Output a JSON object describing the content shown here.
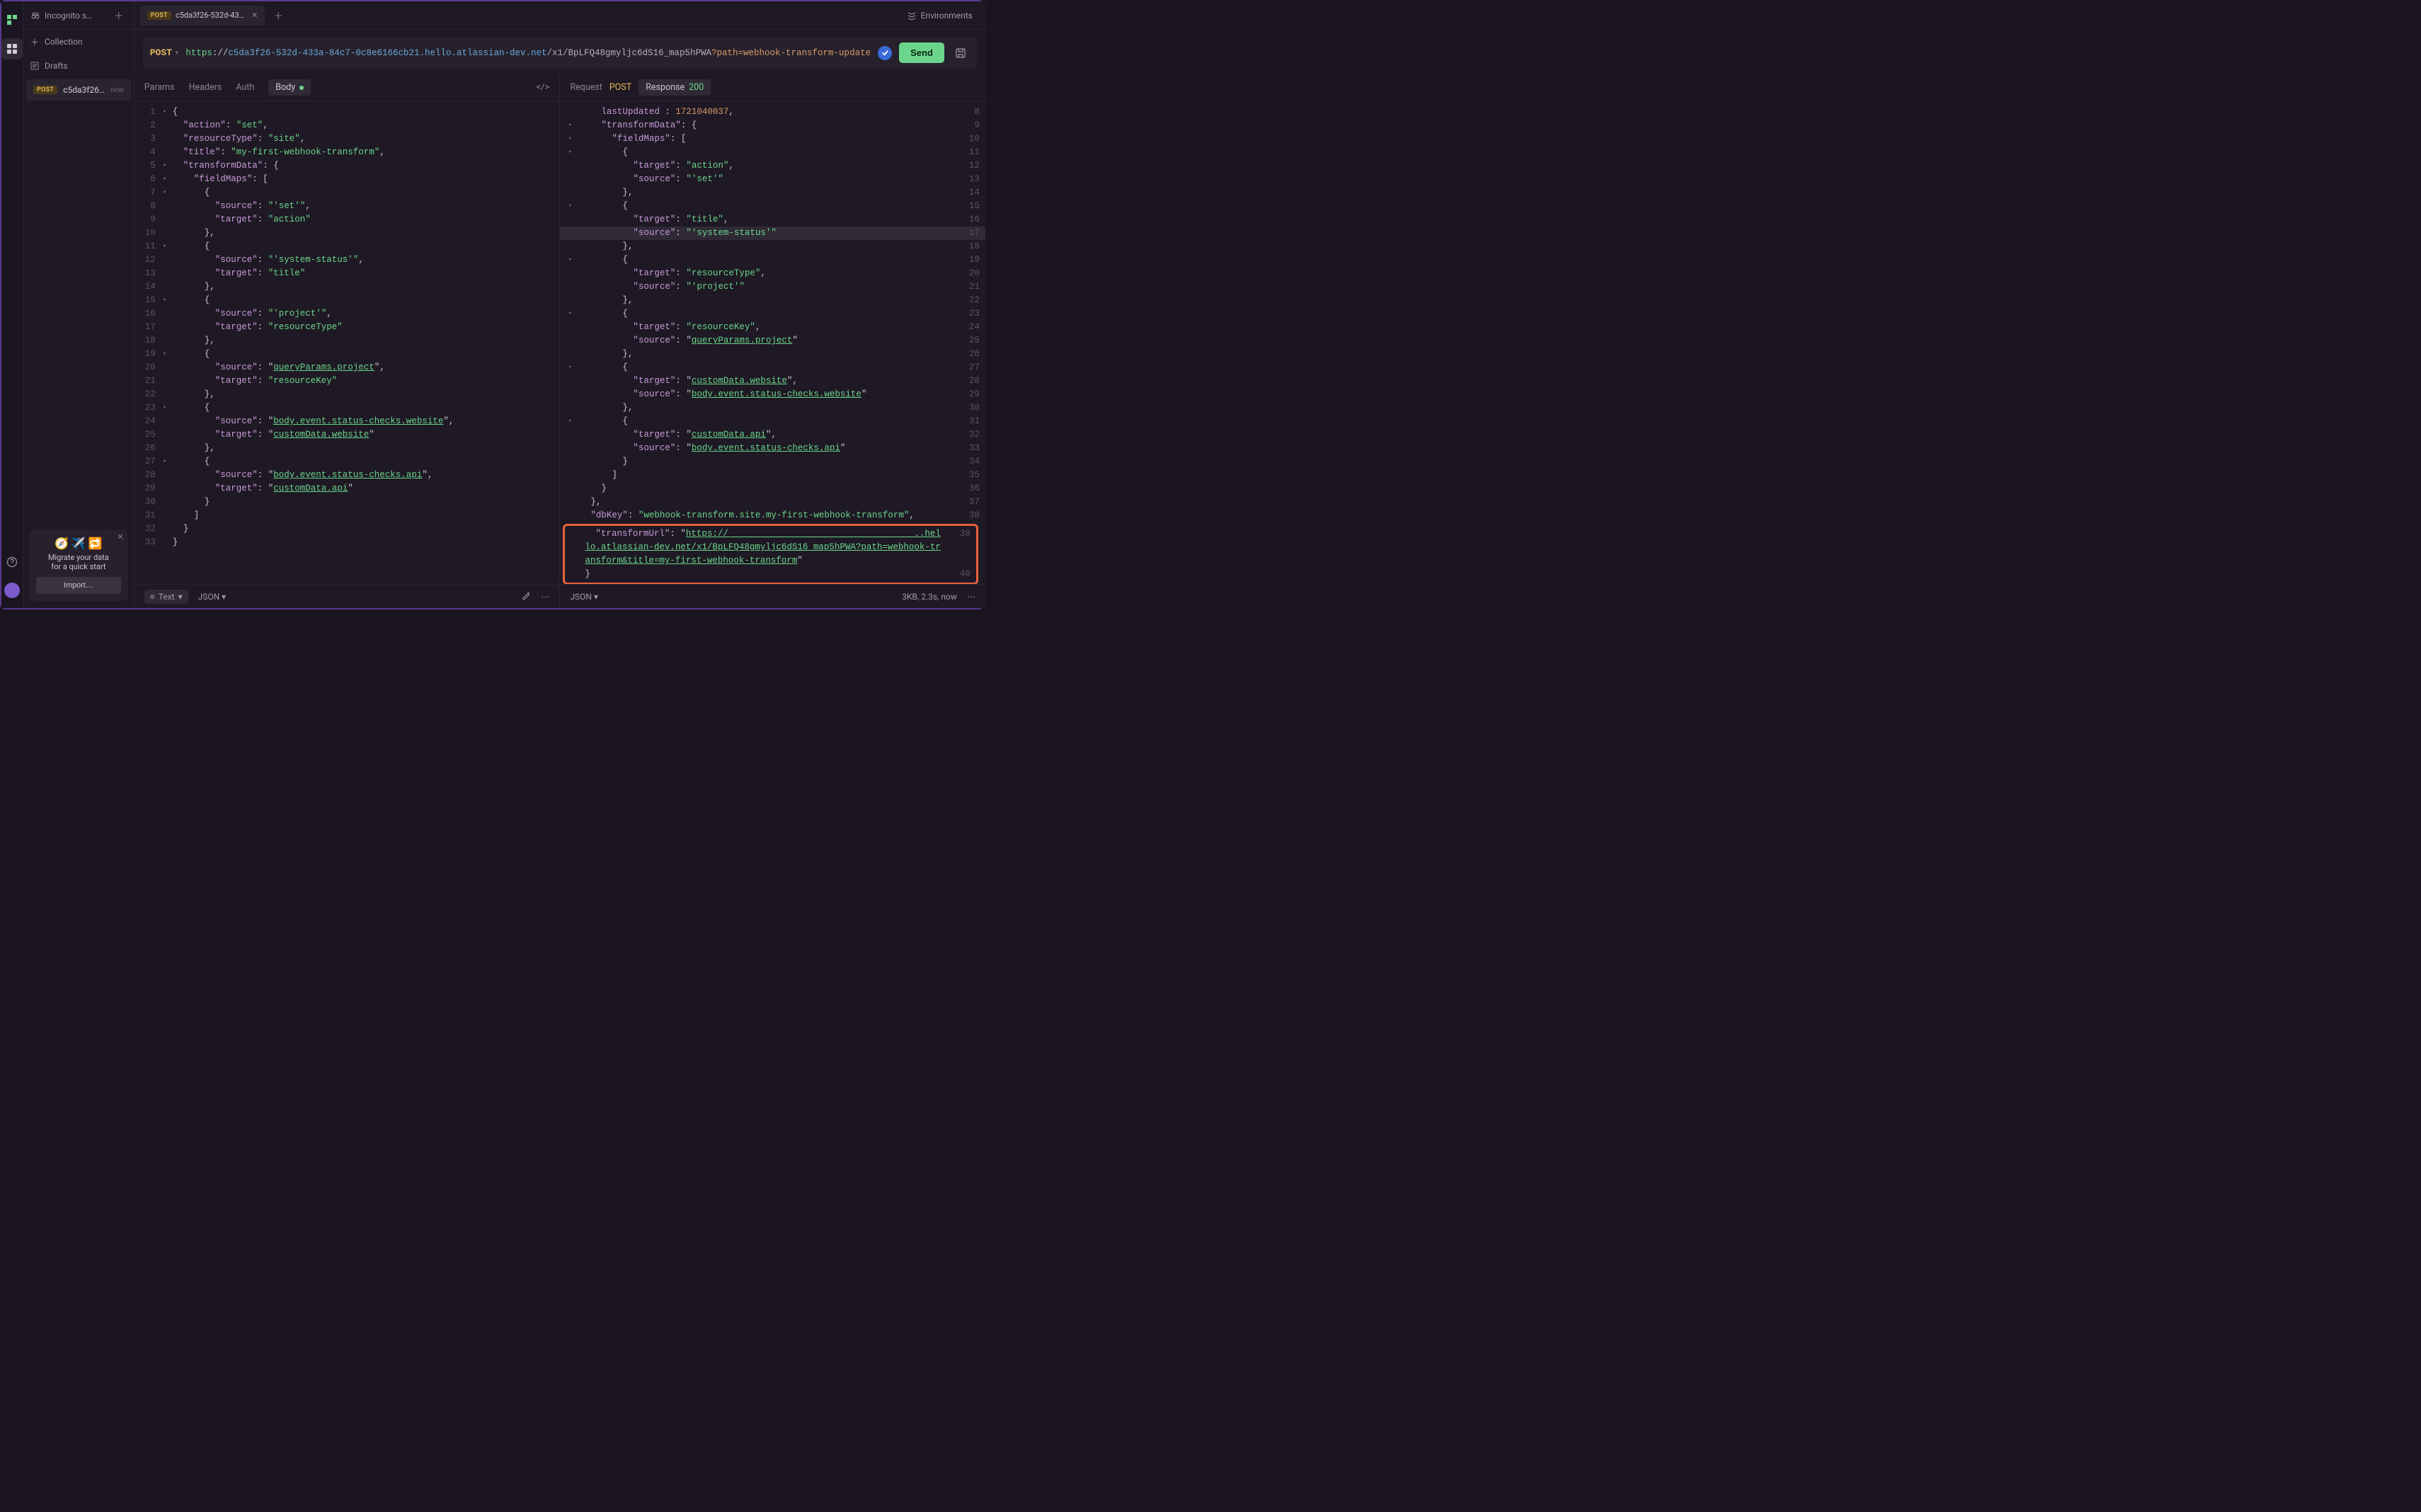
{
  "rail": {},
  "sidebar": {
    "tab_label": "Incognito s…",
    "collection_label": "Collection",
    "drafts_label": "Drafts",
    "item": {
      "badge": "POST",
      "title": "c5da3f26…",
      "time": "now"
    }
  },
  "migrate": {
    "line1": "Migrate your data",
    "line2": "for a quick start",
    "button": "Import…"
  },
  "reqtab": {
    "badge": "POST",
    "title": "c5da3f26-532d-43…"
  },
  "env_label": "Environments",
  "url": {
    "method": "POST",
    "scheme": "https",
    "sep": "://",
    "host": "c5da3f26-532d-433a-84c7-0c8e6166cb21.hello.atlassian-dev.net",
    "path": "/x1/BpLFQ48gmyljc6dS16_map5hPWA",
    "query_raw": "?path=webhook-transform-update"
  },
  "send_label": "Send",
  "subtabs": {
    "params": "Params",
    "headers": "Headers",
    "auth": "Auth",
    "body": "Body"
  },
  "resp": {
    "request_lbl": "Request",
    "request_method": "POST",
    "response_lbl": "Response",
    "status": "200"
  },
  "footer_left": {
    "text_label": "Text",
    "json_label": "JSON"
  },
  "footer_right": {
    "json_label": "JSON",
    "meta": "3KB, 2.3s, now"
  },
  "body_lines": [
    {
      "n": 1,
      "f": "▾",
      "ind": 0,
      "seg": [
        {
          "t": "{",
          "c": "p"
        }
      ]
    },
    {
      "n": 2,
      "ind": 1,
      "seg": [
        {
          "t": "\"action\"",
          "c": "k"
        },
        {
          "t": ": ",
          "c": "p"
        },
        {
          "t": "\"set\"",
          "c": "s"
        },
        {
          "t": ",",
          "c": "p"
        }
      ]
    },
    {
      "n": 3,
      "ind": 1,
      "seg": [
        {
          "t": "\"resourceType\"",
          "c": "k"
        },
        {
          "t": ": ",
          "c": "p"
        },
        {
          "t": "\"site\"",
          "c": "s"
        },
        {
          "t": ",",
          "c": "p"
        }
      ]
    },
    {
      "n": 4,
      "ind": 1,
      "seg": [
        {
          "t": "\"title\"",
          "c": "k"
        },
        {
          "t": ": ",
          "c": "p"
        },
        {
          "t": "\"my-first-webhook-transform\"",
          "c": "s"
        },
        {
          "t": ",",
          "c": "p"
        }
      ]
    },
    {
      "n": 5,
      "f": "▾",
      "ind": 1,
      "seg": [
        {
          "t": "\"transformData\"",
          "c": "k"
        },
        {
          "t": ": {",
          "c": "p"
        }
      ]
    },
    {
      "n": 6,
      "f": "▾",
      "ind": 2,
      "seg": [
        {
          "t": "\"fieldMaps\"",
          "c": "k"
        },
        {
          "t": ": [",
          "c": "p"
        }
      ]
    },
    {
      "n": 7,
      "f": "▾",
      "ind": 3,
      "seg": [
        {
          "t": "{",
          "c": "p"
        }
      ]
    },
    {
      "n": 8,
      "ind": 4,
      "seg": [
        {
          "t": "\"source\"",
          "c": "k"
        },
        {
          "t": ": ",
          "c": "p"
        },
        {
          "t": "\"'set'\"",
          "c": "s"
        },
        {
          "t": ",",
          "c": "p"
        }
      ]
    },
    {
      "n": 9,
      "ind": 4,
      "seg": [
        {
          "t": "\"target\"",
          "c": "k"
        },
        {
          "t": ": ",
          "c": "p"
        },
        {
          "t": "\"action\"",
          "c": "s"
        }
      ]
    },
    {
      "n": 10,
      "ind": 3,
      "seg": [
        {
          "t": "},",
          "c": "p"
        }
      ]
    },
    {
      "n": 11,
      "f": "▾",
      "ind": 3,
      "seg": [
        {
          "t": "{",
          "c": "p"
        }
      ]
    },
    {
      "n": 12,
      "ind": 4,
      "seg": [
        {
          "t": "\"source\"",
          "c": "k"
        },
        {
          "t": ": ",
          "c": "p"
        },
        {
          "t": "\"'system-status'\"",
          "c": "s"
        },
        {
          "t": ",",
          "c": "p"
        }
      ]
    },
    {
      "n": 13,
      "ind": 4,
      "seg": [
        {
          "t": "\"target\"",
          "c": "k"
        },
        {
          "t": ": ",
          "c": "p"
        },
        {
          "t": "\"title\"",
          "c": "s"
        }
      ]
    },
    {
      "n": 14,
      "ind": 3,
      "seg": [
        {
          "t": "},",
          "c": "p"
        }
      ]
    },
    {
      "n": 15,
      "f": "▾",
      "ind": 3,
      "seg": [
        {
          "t": "{",
          "c": "p"
        }
      ]
    },
    {
      "n": 16,
      "ind": 4,
      "seg": [
        {
          "t": "\"source\"",
          "c": "k"
        },
        {
          "t": ": ",
          "c": "p"
        },
        {
          "t": "\"'project'\"",
          "c": "s"
        },
        {
          "t": ",",
          "c": "p"
        }
      ]
    },
    {
      "n": 17,
      "ind": 4,
      "seg": [
        {
          "t": "\"target\"",
          "c": "k"
        },
        {
          "t": ": ",
          "c": "p"
        },
        {
          "t": "\"resourceType\"",
          "c": "s"
        }
      ]
    },
    {
      "n": 18,
      "ind": 3,
      "seg": [
        {
          "t": "},",
          "c": "p"
        }
      ]
    },
    {
      "n": 19,
      "f": "▾",
      "ind": 3,
      "seg": [
        {
          "t": "{",
          "c": "p"
        }
      ]
    },
    {
      "n": 20,
      "ind": 4,
      "seg": [
        {
          "t": "\"source\"",
          "c": "k"
        },
        {
          "t": ": \"",
          "c": "p"
        },
        {
          "t": "queryParams.project",
          "c": "sl"
        },
        {
          "t": "\",",
          "c": "p"
        }
      ]
    },
    {
      "n": 21,
      "ind": 4,
      "seg": [
        {
          "t": "\"target\"",
          "c": "k"
        },
        {
          "t": ": ",
          "c": "p"
        },
        {
          "t": "\"resourceKey\"",
          "c": "s"
        }
      ]
    },
    {
      "n": 22,
      "ind": 3,
      "seg": [
        {
          "t": "},",
          "c": "p"
        }
      ]
    },
    {
      "n": 23,
      "f": "▾",
      "ind": 3,
      "seg": [
        {
          "t": "{",
          "c": "p"
        }
      ]
    },
    {
      "n": 24,
      "ind": 4,
      "seg": [
        {
          "t": "\"source\"",
          "c": "k"
        },
        {
          "t": ": \"",
          "c": "p"
        },
        {
          "t": "body.event.status-checks.website",
          "c": "sl"
        },
        {
          "t": "\",",
          "c": "p"
        }
      ]
    },
    {
      "n": 25,
      "ind": 4,
      "seg": [
        {
          "t": "\"target\"",
          "c": "k"
        },
        {
          "t": ": \"",
          "c": "p"
        },
        {
          "t": "customData.website",
          "c": "sl"
        },
        {
          "t": "\"",
          "c": "p"
        }
      ]
    },
    {
      "n": 26,
      "ind": 3,
      "seg": [
        {
          "t": "},",
          "c": "p"
        }
      ]
    },
    {
      "n": 27,
      "f": "▾",
      "ind": 3,
      "seg": [
        {
          "t": "{",
          "c": "p"
        }
      ]
    },
    {
      "n": 28,
      "ind": 4,
      "seg": [
        {
          "t": "\"source\"",
          "c": "k"
        },
        {
          "t": ": \"",
          "c": "p"
        },
        {
          "t": "body.event.status-checks.api",
          "c": "sl"
        },
        {
          "t": "\",",
          "c": "p"
        }
      ]
    },
    {
      "n": 29,
      "ind": 4,
      "seg": [
        {
          "t": "\"target\"",
          "c": "k"
        },
        {
          "t": ": \"",
          "c": "p"
        },
        {
          "t": "customData.api",
          "c": "sl"
        },
        {
          "t": "\"",
          "c": "p"
        }
      ]
    },
    {
      "n": 30,
      "ind": 3,
      "seg": [
        {
          "t": "}",
          "c": "p"
        }
      ]
    },
    {
      "n": 31,
      "ind": 2,
      "seg": [
        {
          "t": "]",
          "c": "p"
        }
      ]
    },
    {
      "n": 32,
      "ind": 1,
      "seg": [
        {
          "t": "}",
          "c": "p"
        }
      ]
    },
    {
      "n": 33,
      "ind": 0,
      "seg": [
        {
          "t": "}",
          "c": "p"
        }
      ]
    }
  ],
  "resp_lines": [
    {
      "rn": 8,
      "ind": 2,
      "seg": [
        {
          "t": "lastUpdated",
          "c": "k"
        },
        {
          "t": " : ",
          "c": "p"
        },
        {
          "t": "1721040037",
          "c": "n"
        },
        {
          "t": ",",
          "c": "p"
        }
      ]
    },
    {
      "rn": 9,
      "f": "▾",
      "ind": 2,
      "seg": [
        {
          "t": "\"transformData\"",
          "c": "k"
        },
        {
          "t": ": {",
          "c": "p"
        }
      ]
    },
    {
      "rn": 10,
      "f": "▾",
      "ind": 3,
      "seg": [
        {
          "t": "\"fieldMaps\"",
          "c": "k"
        },
        {
          "t": ": [",
          "c": "p"
        }
      ]
    },
    {
      "rn": 11,
      "f": "▾",
      "ind": 4,
      "seg": [
        {
          "t": "{",
          "c": "p"
        }
      ]
    },
    {
      "rn": 12,
      "ind": 5,
      "seg": [
        {
          "t": "\"target\"",
          "c": "k"
        },
        {
          "t": ": ",
          "c": "p"
        },
        {
          "t": "\"action\"",
          "c": "s"
        },
        {
          "t": ",",
          "c": "p"
        }
      ]
    },
    {
      "rn": 13,
      "ind": 5,
      "seg": [
        {
          "t": "\"source\"",
          "c": "k"
        },
        {
          "t": ": ",
          "c": "p"
        },
        {
          "t": "\"'set'\"",
          "c": "s"
        }
      ]
    },
    {
      "rn": 14,
      "ind": 4,
      "seg": [
        {
          "t": "},",
          "c": "p"
        }
      ]
    },
    {
      "rn": 15,
      "f": "▾",
      "ind": 4,
      "seg": [
        {
          "t": "{",
          "c": "p"
        }
      ]
    },
    {
      "rn": 16,
      "ind": 5,
      "seg": [
        {
          "t": "\"target\"",
          "c": "k"
        },
        {
          "t": ": ",
          "c": "p"
        },
        {
          "t": "\"title\"",
          "c": "s"
        },
        {
          "t": ",",
          "c": "p"
        }
      ]
    },
    {
      "rn": 17,
      "hl": true,
      "ind": 5,
      "seg": [
        {
          "t": "\"source\"",
          "c": "k"
        },
        {
          "t": ": ",
          "c": "p"
        },
        {
          "t": "\"'system-status'\"",
          "c": "s"
        }
      ]
    },
    {
      "rn": 18,
      "ind": 4,
      "seg": [
        {
          "t": "},",
          "c": "p"
        }
      ]
    },
    {
      "rn": 19,
      "f": "▾",
      "ind": 4,
      "seg": [
        {
          "t": "{",
          "c": "p"
        }
      ]
    },
    {
      "rn": 20,
      "ind": 5,
      "seg": [
        {
          "t": "\"target\"",
          "c": "k"
        },
        {
          "t": ": ",
          "c": "p"
        },
        {
          "t": "\"resourceType\"",
          "c": "s"
        },
        {
          "t": ",",
          "c": "p"
        }
      ]
    },
    {
      "rn": 21,
      "ind": 5,
      "seg": [
        {
          "t": "\"source\"",
          "c": "k"
        },
        {
          "t": ": ",
          "c": "p"
        },
        {
          "t": "\"'project'\"",
          "c": "s"
        }
      ]
    },
    {
      "rn": 22,
      "ind": 4,
      "seg": [
        {
          "t": "},",
          "c": "p"
        }
      ]
    },
    {
      "rn": 23,
      "f": "▾",
      "ind": 4,
      "seg": [
        {
          "t": "{",
          "c": "p"
        }
      ]
    },
    {
      "rn": 24,
      "ind": 5,
      "seg": [
        {
          "t": "\"target\"",
          "c": "k"
        },
        {
          "t": ": ",
          "c": "p"
        },
        {
          "t": "\"resourceKey\"",
          "c": "s"
        },
        {
          "t": ",",
          "c": "p"
        }
      ]
    },
    {
      "rn": 25,
      "ind": 5,
      "seg": [
        {
          "t": "\"source\"",
          "c": "k"
        },
        {
          "t": ": \"",
          "c": "p"
        },
        {
          "t": "queryParams.project",
          "c": "sl"
        },
        {
          "t": "\"",
          "c": "p"
        }
      ]
    },
    {
      "rn": 26,
      "ind": 4,
      "seg": [
        {
          "t": "},",
          "c": "p"
        }
      ]
    },
    {
      "rn": 27,
      "f": "▾",
      "ind": 4,
      "seg": [
        {
          "t": "{",
          "c": "p"
        }
      ]
    },
    {
      "rn": 28,
      "ind": 5,
      "seg": [
        {
          "t": "\"target\"",
          "c": "k"
        },
        {
          "t": ": \"",
          "c": "p"
        },
        {
          "t": "customData.website",
          "c": "sl"
        },
        {
          "t": "\",",
          "c": "p"
        }
      ]
    },
    {
      "rn": 29,
      "ind": 5,
      "seg": [
        {
          "t": "\"source\"",
          "c": "k"
        },
        {
          "t": ": \"",
          "c": "p"
        },
        {
          "t": "body.event.status-checks.website",
          "c": "sl"
        },
        {
          "t": "\"",
          "c": "p"
        }
      ]
    },
    {
      "rn": 30,
      "ind": 4,
      "seg": [
        {
          "t": "},",
          "c": "p"
        }
      ]
    },
    {
      "rn": 31,
      "f": "▾",
      "ind": 4,
      "seg": [
        {
          "t": "{",
          "c": "p"
        }
      ]
    },
    {
      "rn": 32,
      "ind": 5,
      "seg": [
        {
          "t": "\"target\"",
          "c": "k"
        },
        {
          "t": ": \"",
          "c": "p"
        },
        {
          "t": "customData.api",
          "c": "sl"
        },
        {
          "t": "\",",
          "c": "p"
        }
      ]
    },
    {
      "rn": 33,
      "ind": 5,
      "seg": [
        {
          "t": "\"source\"",
          "c": "k"
        },
        {
          "t": ": \"",
          "c": "p"
        },
        {
          "t": "body.event.status-checks.api",
          "c": "sl"
        },
        {
          "t": "\"",
          "c": "p"
        }
      ]
    },
    {
      "rn": 34,
      "ind": 4,
      "seg": [
        {
          "t": "}",
          "c": "p"
        }
      ]
    },
    {
      "rn": 35,
      "ind": 3,
      "seg": [
        {
          "t": "]",
          "c": "p"
        }
      ]
    },
    {
      "rn": 36,
      "ind": 2,
      "seg": [
        {
          "t": "}",
          "c": "p"
        }
      ]
    },
    {
      "rn": 37,
      "ind": 1,
      "seg": [
        {
          "t": "},",
          "c": "p"
        }
      ]
    },
    {
      "rn": 38,
      "ind": 1,
      "seg": [
        {
          "t": "\"dbKey\"",
          "c": "k"
        },
        {
          "t": ": ",
          "c": "p"
        },
        {
          "t": "\"webhook-transform.site.my-first-webhook-transform\"",
          "c": "s"
        },
        {
          "t": ",",
          "c": "p"
        }
      ]
    }
  ],
  "resp_highlight": [
    {
      "rn": 39,
      "ind": 1,
      "seg": [
        {
          "t": "\"transformUrl\"",
          "c": "k"
        },
        {
          "t": ": \"",
          "c": "p"
        },
        {
          "t": "https://                                   ..hello.atlassian-dev.net/x1/BpLFQ48gmyljc6dS16_map5hPWA?path=webhook-transform&title=my-first-webhook-transform",
          "c": "sl"
        },
        {
          "t": "\"",
          "c": "p"
        }
      ]
    },
    {
      "rn": 40,
      "ind": 0,
      "seg": [
        {
          "t": "}",
          "c": "p"
        }
      ]
    }
  ]
}
